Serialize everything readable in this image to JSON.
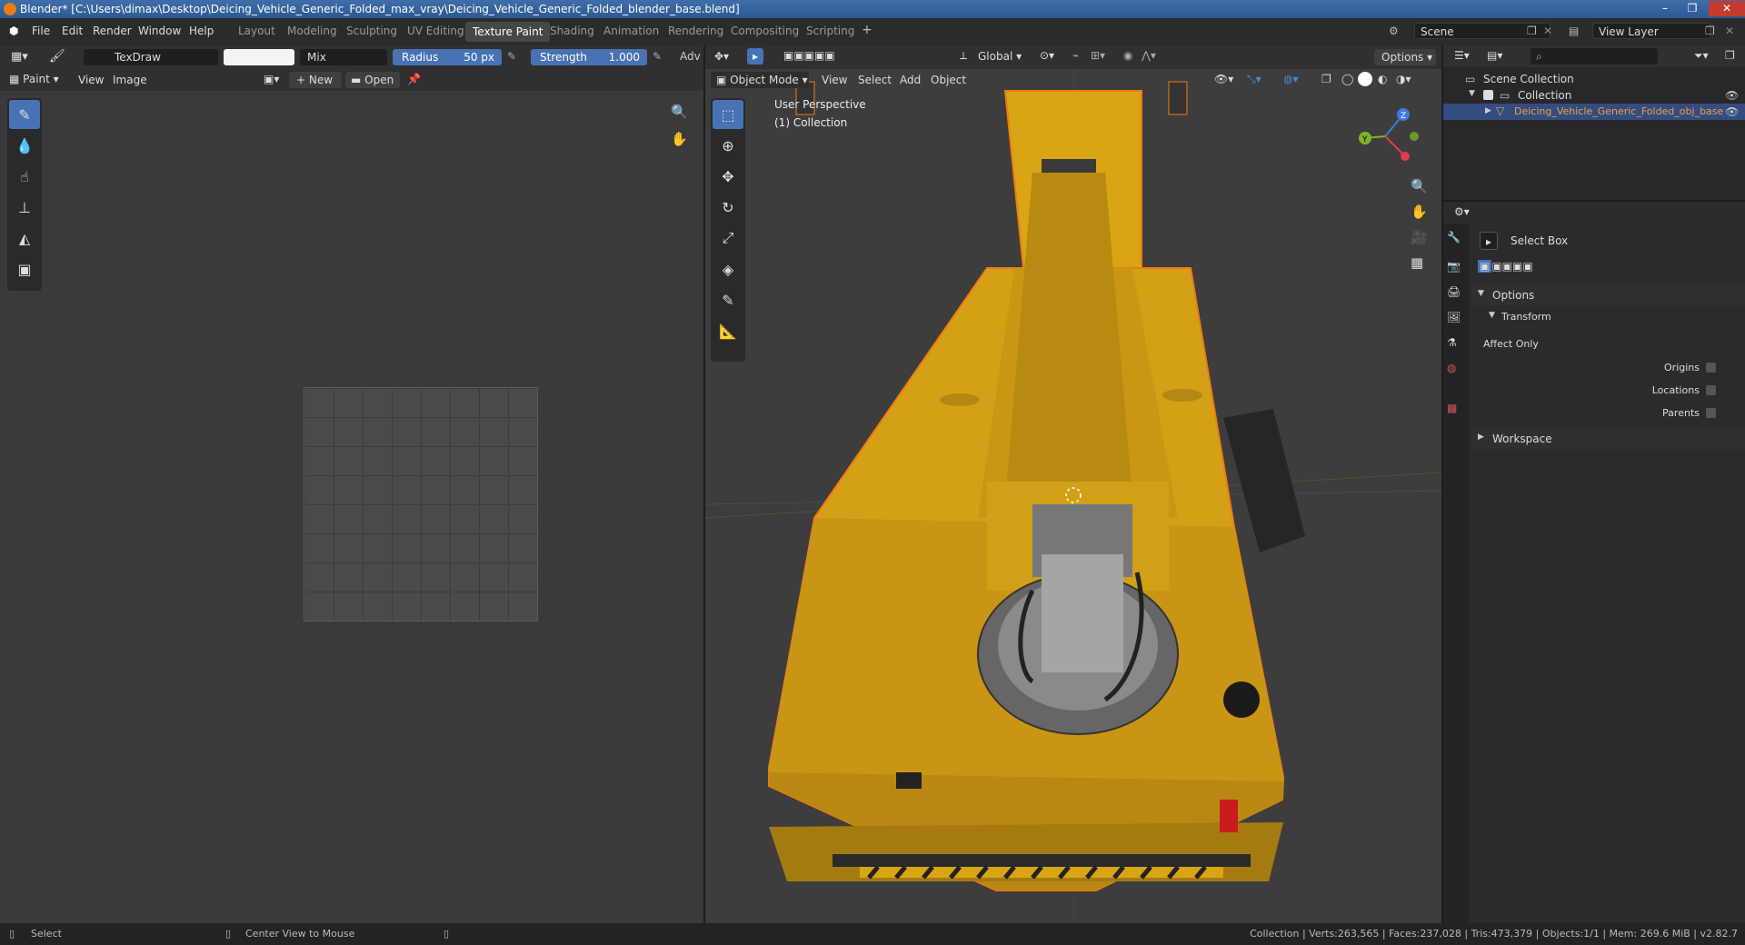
{
  "titlebar": {
    "title": "Blender* [C:\\Users\\dimax\\Desktop\\Deicing_Vehicle_Generic_Folded_max_vray\\Deicing_Vehicle_Generic_Folded_blender_base.blend]"
  },
  "menu": {
    "file": "File",
    "edit": "Edit",
    "render": "Render",
    "window": "Window",
    "help": "Help"
  },
  "workspaces": [
    "Layout",
    "Modeling",
    "Sculpting",
    "UV Editing",
    "Texture Paint",
    "Shading",
    "Animation",
    "Rendering",
    "Compositing",
    "Scripting"
  ],
  "scene": {
    "label": "Scene",
    "view_layer": "View Layer"
  },
  "paint_header": {
    "brush": "TexDraw",
    "blend": "Mix",
    "radius_label": "Radius",
    "radius_value": "50 px",
    "strength_label": "Strength",
    "strength_value": "1.000",
    "adv": "Adv"
  },
  "image_header": {
    "mode": "Paint",
    "view": "View",
    "image": "Image",
    "new": "New",
    "open": "Open"
  },
  "viewport_header": {
    "orientation": "Global",
    "options": "Options",
    "mode": "Object Mode",
    "view": "View",
    "select": "Select",
    "add": "Add",
    "object": "Object"
  },
  "viewport": {
    "perspective": "User Perspective",
    "collection": "(1) Collection"
  },
  "outliner": {
    "scene_collection": "Scene Collection",
    "collection": "Collection",
    "object": "Deicing_Vehicle_Generic_Folded_obj_base"
  },
  "properties": {
    "tool": "Select Box",
    "options": "Options",
    "transform": "Transform",
    "affect_only": "Affect Only",
    "origins": "Origins",
    "locations": "Locations",
    "parents": "Parents",
    "workspace": "Workspace"
  },
  "status": {
    "select": "Select",
    "center_view": "Center View to Mouse",
    "stats": "Collection | Verts:263,565 | Faces:237,028 | Tris:473,379 | Objects:1/1 | Mem: 269.6 MiB | v2.82.7"
  },
  "colors": {
    "accent": "#4772b3",
    "selected": "#e87d0d",
    "vehicle": "#d9a514"
  }
}
